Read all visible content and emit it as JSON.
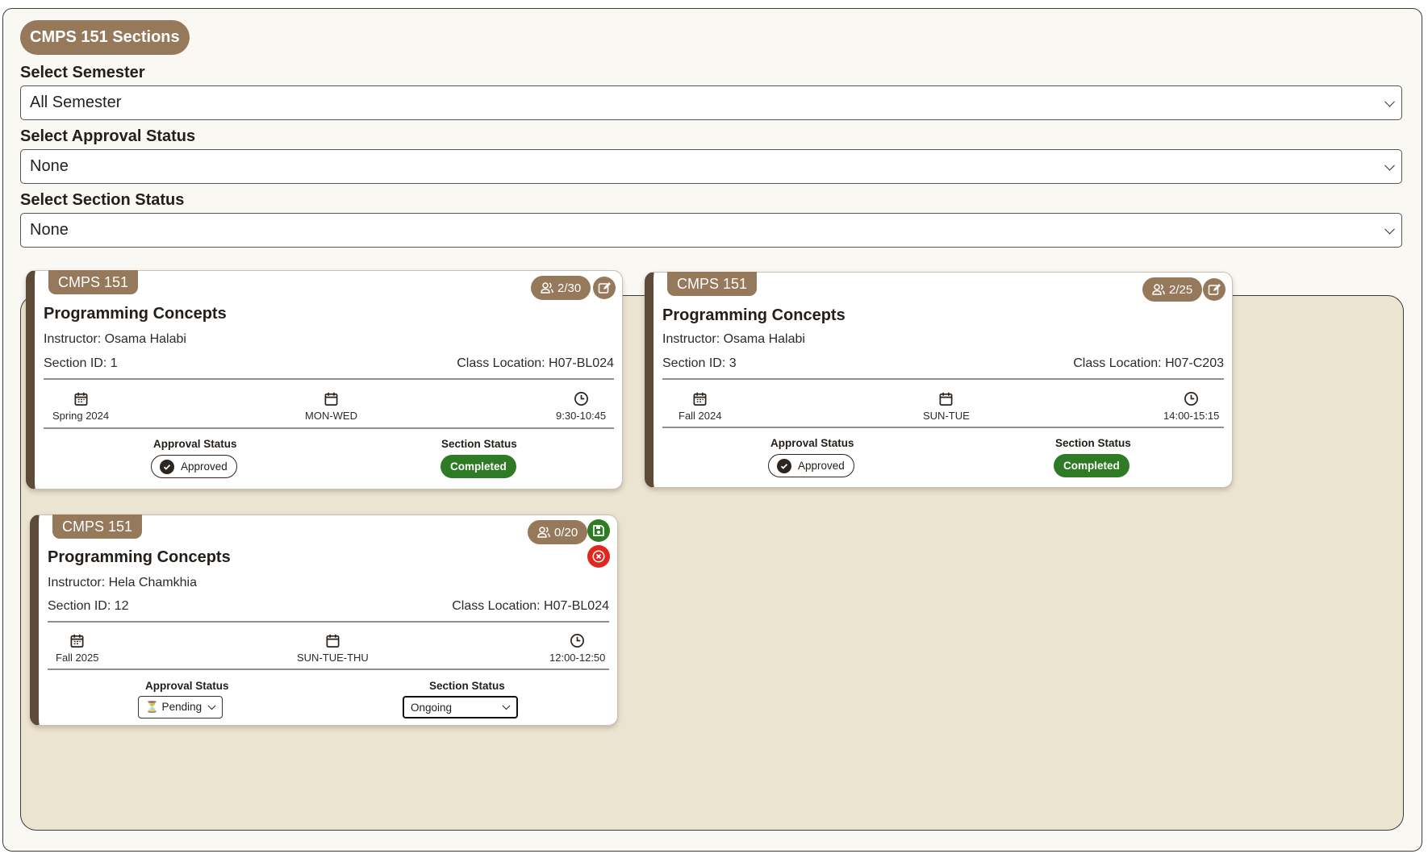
{
  "header": {
    "title": "CMPS 151 Sections"
  },
  "filters": {
    "semester": {
      "label": "Select Semester",
      "value": "All Semester"
    },
    "approval": {
      "label": "Select Approval Status",
      "value": "None"
    },
    "section": {
      "label": "Select Section Status",
      "value": "None"
    }
  },
  "labels": {
    "approval_status": "Approval Status",
    "section_status": "Section Status"
  },
  "cards": [
    {
      "course_code": "CMPS 151",
      "title": "Programming Concepts",
      "instructor": "Instructor: Osama Halabi",
      "section_id": "Section ID: 1",
      "location": "Class Location: H07-BL024",
      "enrollment": "2/30",
      "semester": "Spring 2024",
      "days": "MON-WED",
      "time": "9:30-10:45",
      "approval": "Approved",
      "status": "Completed",
      "mode": "view"
    },
    {
      "course_code": "CMPS 151",
      "title": "Programming Concepts",
      "instructor": "Instructor: Osama Halabi",
      "section_id": "Section ID: 3",
      "location": "Class Location: H07-C203",
      "enrollment": "2/25",
      "semester": "Fall 2024",
      "days": "SUN-TUE",
      "time": "14:00-15:15",
      "approval": "Approved",
      "status": "Completed",
      "mode": "view"
    },
    {
      "course_code": "CMPS 151",
      "title": "Programming Concepts",
      "instructor": "Instructor: Hela Chamkhia",
      "section_id": "Section ID: 12",
      "location": "Class Location: H07-BL024",
      "enrollment": "0/20",
      "semester": "Fall 2025",
      "days": "SUN-TUE-THU",
      "time": "12:00-12:50",
      "approval": "⏳ Pending",
      "status": "Ongoing",
      "mode": "edit"
    }
  ],
  "icons": {
    "enrollment": "users-icon",
    "edit": "edit-icon",
    "save": "save-icon",
    "cancel": "cancel-icon",
    "semester": "calendar-icon",
    "days": "calendar-day-icon",
    "time": "clock-icon",
    "approved": "check-circle-icon"
  },
  "colors": {
    "brand": "#96785a",
    "accent_dark": "#5e4a38",
    "panel": "#ebe4d0",
    "completed": "#2f7a24",
    "cancel": "#e0281e"
  }
}
